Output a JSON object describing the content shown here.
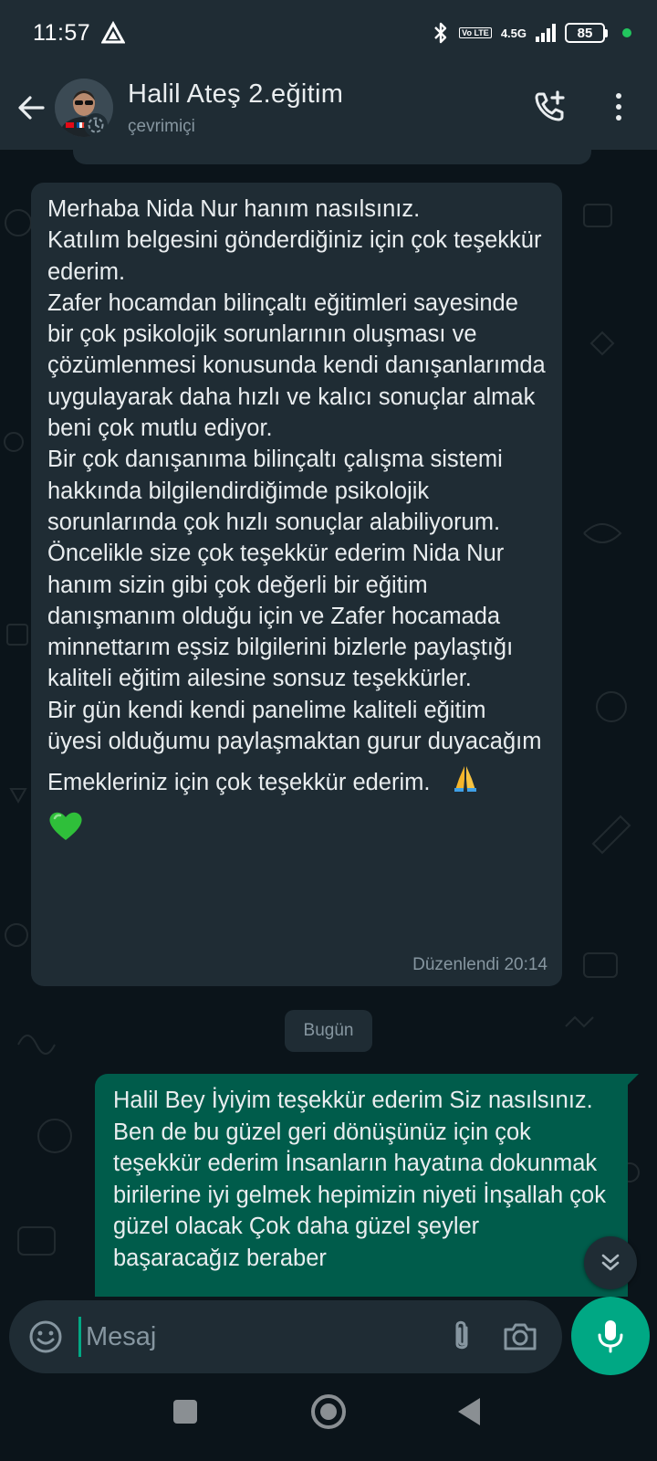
{
  "status_bar": {
    "time": "11:57",
    "network_volte": "Vo LTE",
    "network_type": "4.5G",
    "battery_level": "85",
    "signal_bars": 4
  },
  "header": {
    "contact_name": "Halil Ateş 2.eğitim",
    "contact_status": "çevrimiçi",
    "icons": [
      "back-arrow-icon",
      "avatar",
      "add-call-icon",
      "more-vert-icon"
    ]
  },
  "messages": {
    "incoming": {
      "text": "Merhaba Nida Nur hanım nasılsınız.\nKatılım belgesini gönderdiğiniz için çok teşekkür ederim.\nZafer hocamdan bilinçaltı eğitimleri sayesinde bir çok psikolojik sorunlarının oluşması ve çözümlenmesi konusunda kendi danışanlarımda uygulayarak daha hızlı ve kalıcı sonuçlar almak beni çok mutlu ediyor.\nBir çok danışanıma bilinçaltı çalışma sistemi hakkında bilgilendirdiğimde psikolojik sorunlarında çok hızlı sonuçlar alabiliyorum.\nÖncelikle size çok teşekkür ederim Nida Nur hanım sizin gibi çok değerli bir eğitim danışmanım olduğu için ve Zafer hocamada minnettarım eşsiz bilgilerini bizlerle paylaştığı kaliteli eğitim ailesine sonsuz teşekkürler.\nBir gün kendi kendi panelime kaliteli eğitim üyesi olduğumu paylaşmaktan gurur duyacağım",
      "last_line": "Emekleriniz için çok teşekkür ederim.",
      "emoji_1": "🙏",
      "emoji_2": "💚",
      "meta": "Düzenlendi 20:14"
    },
    "date_chip": "Bugün",
    "outgoing": {
      "text": "Halil Bey İyiyim teşekkür ederim Siz nasılsınız.\nBen de bu güzel geri dönüşünüz için çok teşekkür ederim İnsanların hayatına dokunmak birilerine iyi gelmek hepimizin niyeti İnşallah çok güzel olacak Çok daha güzel şeyler başaracağız beraber"
    }
  },
  "composer": {
    "placeholder": "Mesaj"
  },
  "colors": {
    "header_bg": "#1f2c34",
    "chat_bg": "#0b141a",
    "incoming_bubble": "#1f2c34",
    "outgoing_bubble": "#005c4b",
    "accent": "#00a884",
    "secondary_text": "#8696a0"
  }
}
